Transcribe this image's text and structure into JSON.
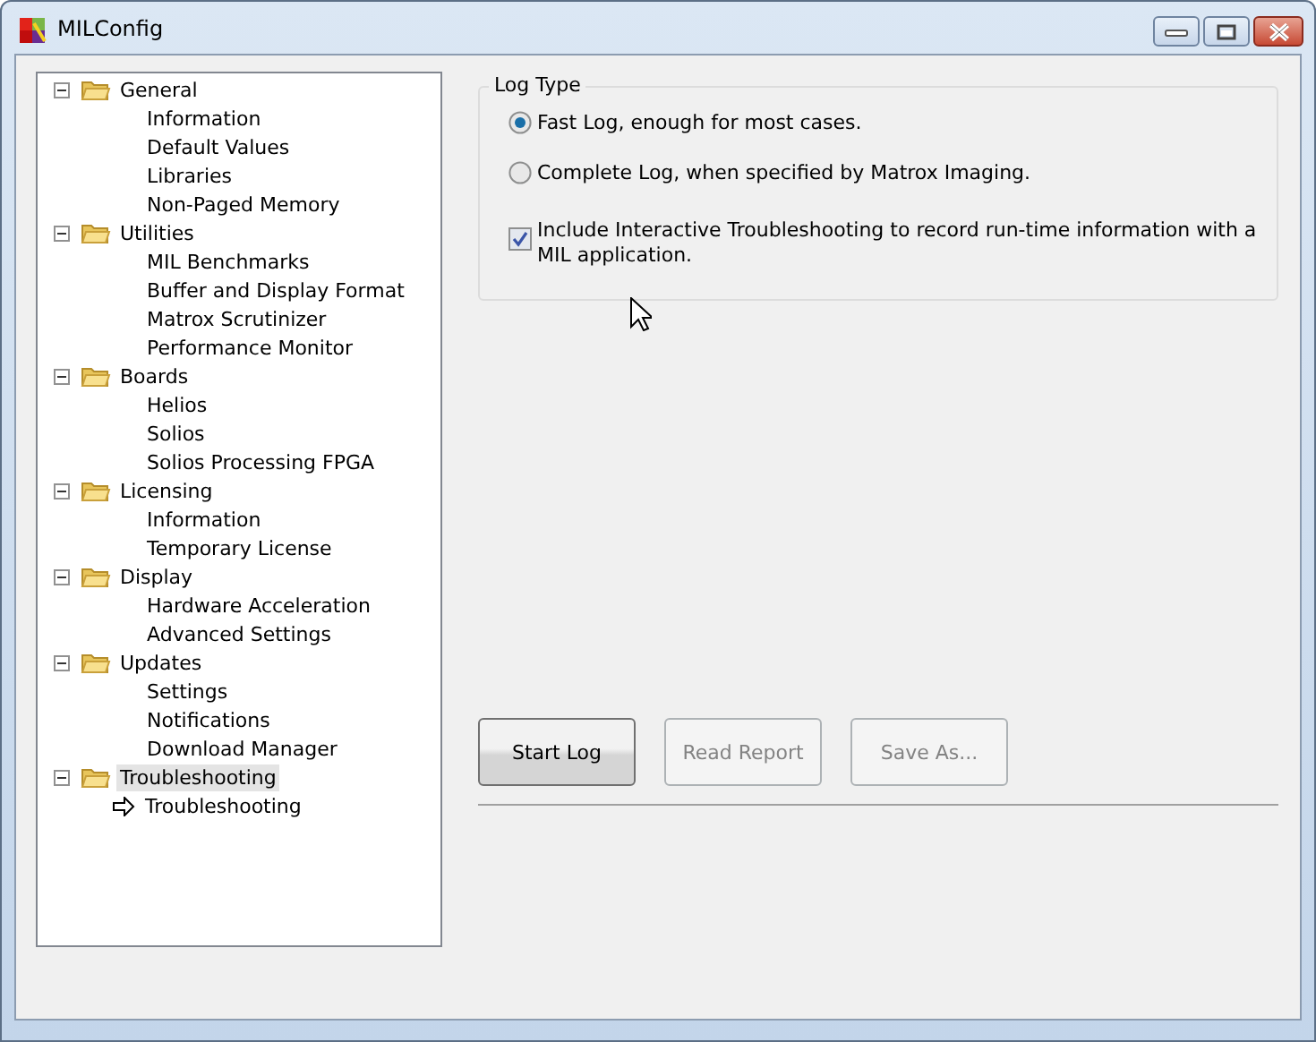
{
  "window": {
    "title": "MILConfig"
  },
  "tree": [
    {
      "label": "General",
      "expanded": true,
      "selected": false,
      "children": [
        {
          "label": "Information",
          "selected": false
        },
        {
          "label": "Default Values",
          "selected": false
        },
        {
          "label": "Libraries",
          "selected": false
        },
        {
          "label": "Non-Paged Memory",
          "selected": false
        }
      ]
    },
    {
      "label": "Utilities",
      "expanded": true,
      "selected": false,
      "children": [
        {
          "label": "MIL Benchmarks",
          "selected": false
        },
        {
          "label": "Buffer and Display Format",
          "selected": false
        },
        {
          "label": "Matrox Scrutinizer",
          "selected": false
        },
        {
          "label": "Performance Monitor",
          "selected": false
        }
      ]
    },
    {
      "label": "Boards",
      "expanded": true,
      "selected": false,
      "children": [
        {
          "label": "Helios",
          "selected": false
        },
        {
          "label": "Solios",
          "selected": false
        },
        {
          "label": "Solios Processing FPGA",
          "selected": false
        }
      ]
    },
    {
      "label": "Licensing",
      "expanded": true,
      "selected": false,
      "children": [
        {
          "label": "Information",
          "selected": false
        },
        {
          "label": "Temporary License",
          "selected": false
        }
      ]
    },
    {
      "label": "Display",
      "expanded": true,
      "selected": false,
      "children": [
        {
          "label": "Hardware Acceleration",
          "selected": false
        },
        {
          "label": "Advanced Settings",
          "selected": false
        }
      ]
    },
    {
      "label": "Updates",
      "expanded": true,
      "selected": false,
      "children": [
        {
          "label": "Settings",
          "selected": false
        },
        {
          "label": "Notifications",
          "selected": false
        },
        {
          "label": "Download Manager",
          "selected": false
        }
      ]
    },
    {
      "label": "Troubleshooting",
      "expanded": true,
      "selected": true,
      "children": [
        {
          "label": "Troubleshooting",
          "selected": true
        }
      ]
    }
  ],
  "log_type": {
    "title": "Log Type",
    "options": [
      {
        "label": "Fast Log, enough for most cases.",
        "selected": true
      },
      {
        "label": "Complete Log, when specified by Matrox Imaging.",
        "selected": false
      }
    ],
    "include_checkbox": {
      "label": "Include Interactive Troubleshooting to record run-time information with a MIL application.",
      "checked": true
    }
  },
  "buttons": [
    {
      "label": "Start Log",
      "disabled": false
    },
    {
      "label": "Read Report",
      "disabled": true
    },
    {
      "label": "Save As...",
      "disabled": true
    }
  ]
}
